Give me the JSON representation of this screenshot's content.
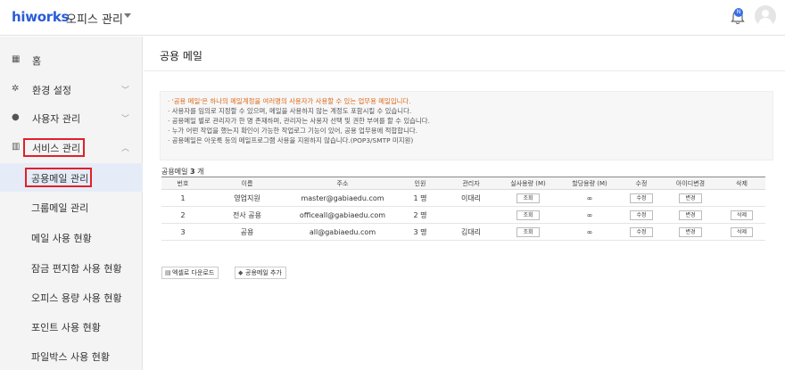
{
  "header": {
    "logo": "hiworks",
    "app_title": "오피스 관리",
    "notification_count": "N"
  },
  "sidebar": {
    "items": [
      {
        "label": "홈",
        "icon": "building-icon"
      },
      {
        "label": "환경 설정",
        "icon": "gear-icon"
      },
      {
        "label": "사용자 관리",
        "icon": "user-icon"
      },
      {
        "label": "서비스 관리",
        "icon": "chart-icon"
      }
    ],
    "submenu": [
      {
        "label": "공용메일 관리"
      },
      {
        "label": "그룹메일 관리"
      },
      {
        "label": "메일 사용 현황"
      },
      {
        "label": "잠금 편지함 사용 현황"
      },
      {
        "label": "오피스 용량 사용 현황"
      },
      {
        "label": "포인트 사용 현황"
      },
      {
        "label": "파일박스 사용 현황"
      }
    ]
  },
  "main": {
    "title": "공용 메일",
    "notice": [
      "· '공용 메일'은 하나의 메일계정을 여러명의 사용자가 사용할 수 있는 업무용 메일입니다.",
      "· 사용자를 임의로 지정할 수 있으며, 메일을 사용하지 않는 계정도 포함시킬 수 있습니다.",
      "· 공용메일 별로 관리자가 한 명 존재하며, 관리자는 사용자 선택 및 권한 부여를 할 수 있습니다.",
      "· 누가 어떤 작업을 했는지 확인이 가능한 작업로그 기능이 있어, 공용 업무용에 적합합니다.",
      "· 공용메일은 아웃룩 등의 메일프로그램 사용을 지원하지 않습니다.(POP3/SMTP 미지원)"
    ],
    "count_label": "공용메일",
    "count_value": "3",
    "count_unit": "개",
    "columns": [
      "번호",
      "이름",
      "주소",
      "인원",
      "관리자",
      "실사용량 (M)",
      "할당용량 (M)",
      "수정",
      "아이디변경",
      "삭제"
    ],
    "rows": [
      {
        "no": "1",
        "name": "영업지원",
        "address": "master@gabiaedu.com",
        "members": "1 명",
        "manager": "이대리",
        "usage": "조회",
        "quota": "∞",
        "edit": "수정",
        "rename": "변경",
        "delete": ""
      },
      {
        "no": "2",
        "name": "전사 공용",
        "address": "officeall@gabiaedu.com",
        "members": "2 명",
        "manager": "",
        "usage": "조회",
        "quota": "∞",
        "edit": "수정",
        "rename": "변경",
        "delete": "삭제"
      },
      {
        "no": "3",
        "name": "공용",
        "address": "all@gabiaedu.com",
        "members": "3 명",
        "manager": "김대리",
        "usage": "조회",
        "quota": "∞",
        "edit": "수정",
        "rename": "변경",
        "delete": "삭제"
      }
    ],
    "excel_button": "엑셀로 다운로드",
    "add_button": "공용메일 추가"
  }
}
